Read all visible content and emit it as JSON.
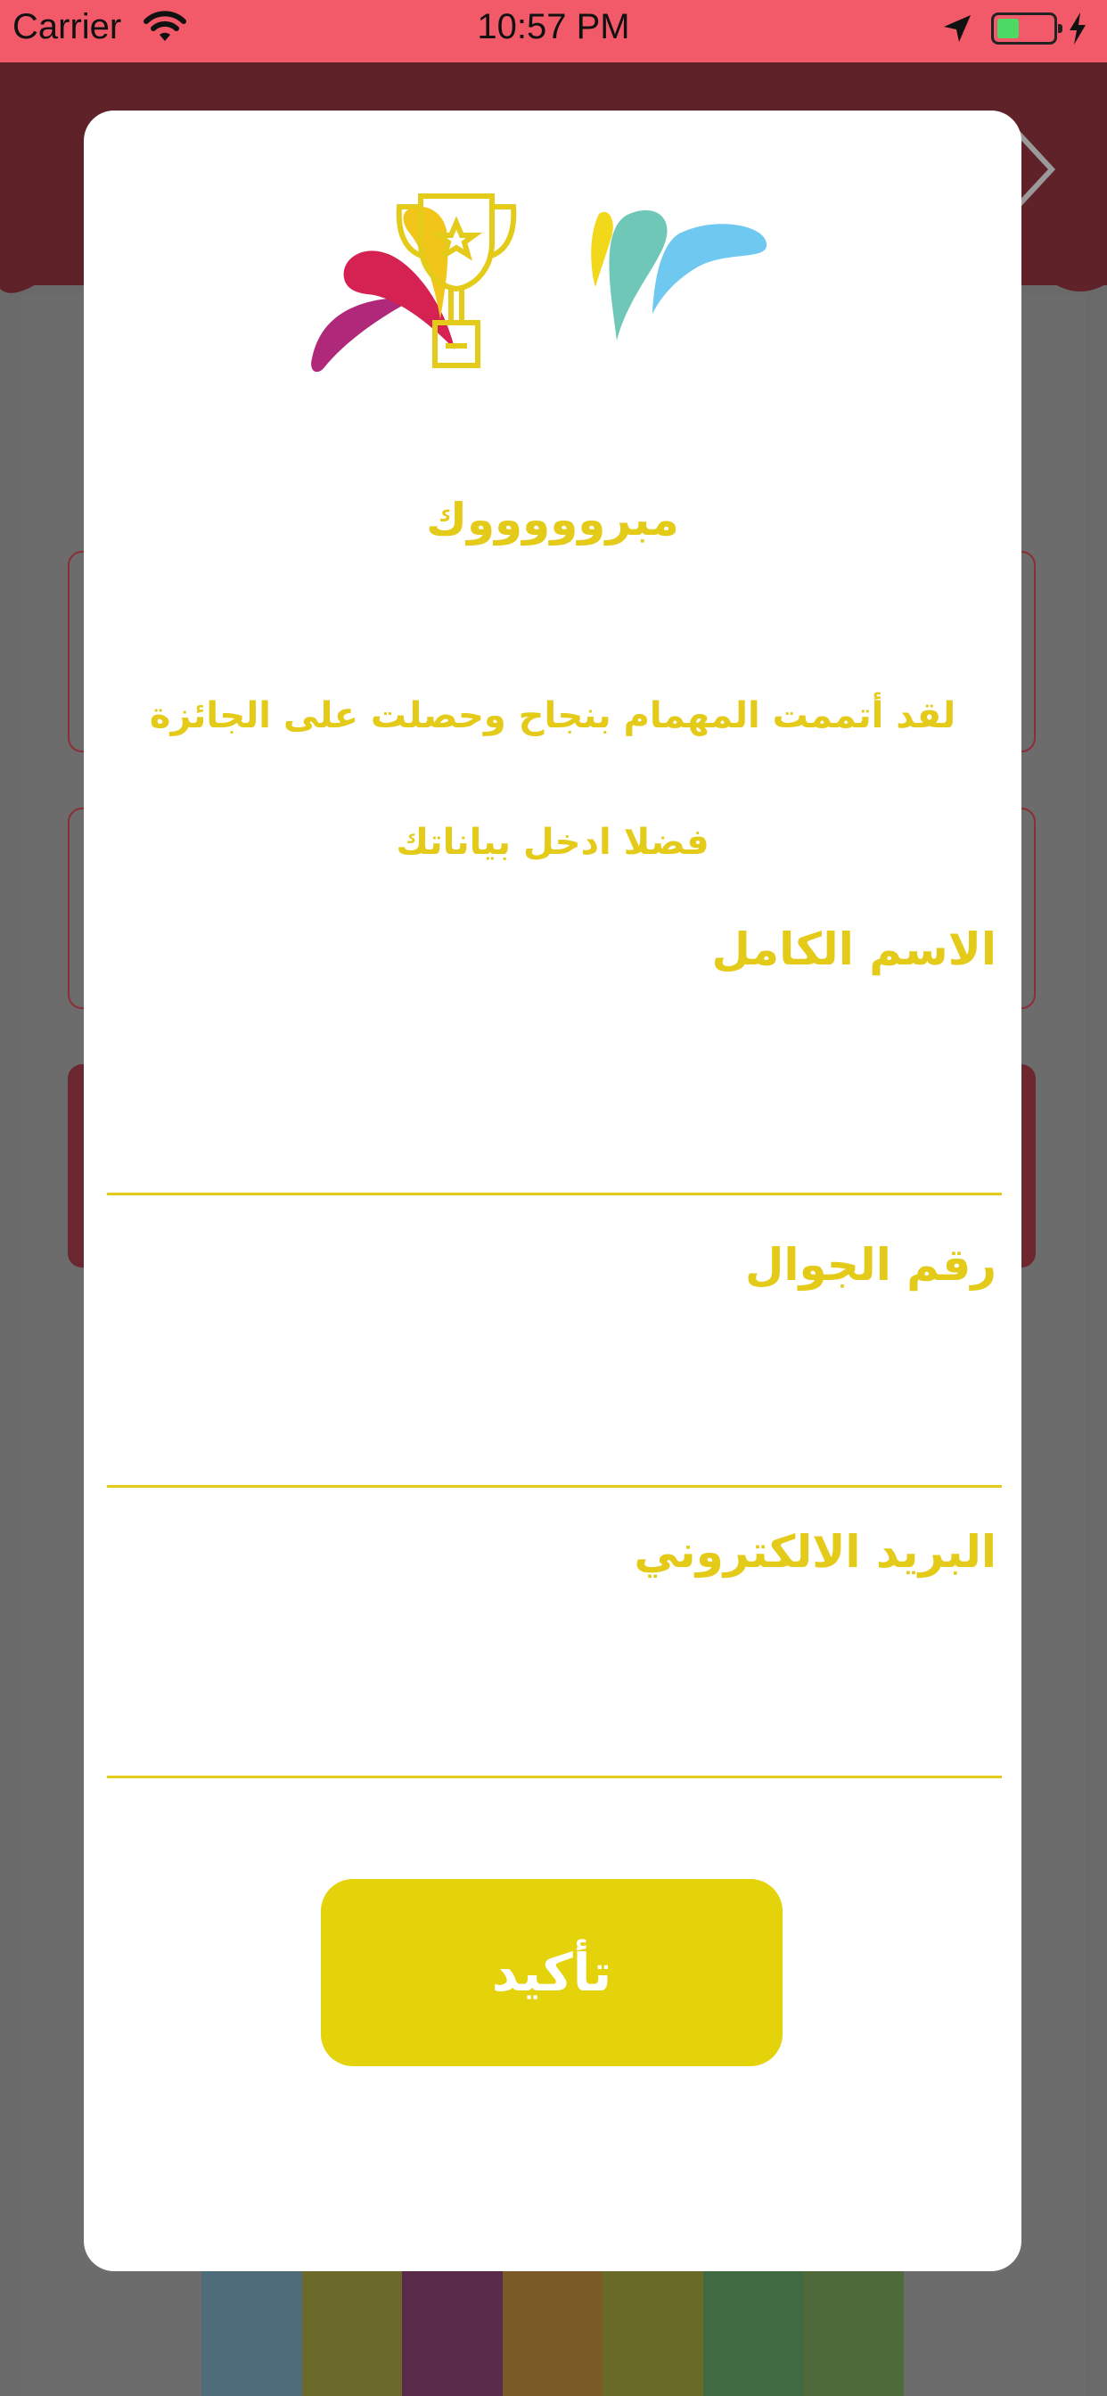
{
  "status_bar": {
    "carrier": "Carrier",
    "time": "10:57 PM",
    "icons": [
      "wifi-icon",
      "location-arrow-icon",
      "battery-icon",
      "charging-bolt-icon"
    ]
  },
  "dialog": {
    "title": "مبروووووك",
    "message": "لقد أتممت المهمام بنجاح وحصلت على الجائزة فضلا ادخل بياناتك",
    "fields": [
      {
        "label": "الاسم الكامل",
        "value": "",
        "placeholder": ""
      },
      {
        "label": "رقم الجوال",
        "value": "",
        "placeholder": ""
      },
      {
        "label": "البريد الالكتروني",
        "value": "",
        "placeholder": ""
      }
    ],
    "confirm_label": "تأكيد"
  },
  "colors": {
    "status_bar": "#f25a69",
    "accent_yellow": "#e4ca19",
    "button_yellow": "#e4d20b",
    "overlay_gray": "#6c6c6c",
    "header_dark_red": "#5f2229"
  }
}
